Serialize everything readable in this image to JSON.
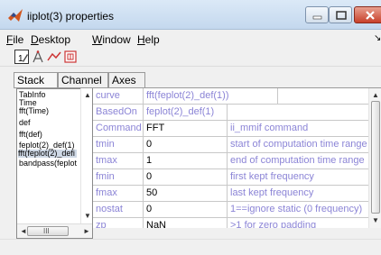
{
  "window": {
    "title": "iiplot(3) properties"
  },
  "menu": [
    {
      "label": "File",
      "ul": "F",
      "rest": "ile"
    },
    {
      "label": "Desktop",
      "ul": "D",
      "rest": "esktop"
    },
    {
      "label": "Window",
      "ul": "W",
      "rest": "indow"
    },
    {
      "label": "Help",
      "ul": "H",
      "rest": "elp"
    }
  ],
  "toolbar": [
    "text-tool-icon",
    "cursor-tool-icon",
    "line-tool-icon",
    "pin-tool-icon"
  ],
  "tabs": [
    "Stack",
    "Channel",
    "Axes"
  ],
  "active_tab": "Stack",
  "list": {
    "items": [
      "TabInfo",
      "Time",
      "fft(Time)",
      "def",
      "fft(def)",
      "feplot(2)_def(1)",
      "fft(feplot(2)_defi",
      "bandpass(feplot"
    ],
    "selected": "fft(feplot(2)_defi",
    "scroll_grip": "III"
  },
  "properties": [
    {
      "name": "curve",
      "value": "fft(feplot(2)_def(1))",
      "desc": "",
      "value_color": "purple"
    },
    {
      "name": "BasedOn",
      "value": "feplot(2)_def(1)",
      "desc": "",
      "value_color": "purple"
    },
    {
      "name": "Command",
      "value": "FFT",
      "desc": "ii_mmif command"
    },
    {
      "name": "tmin",
      "value": "0",
      "desc": "start of computation time range"
    },
    {
      "name": "tmax",
      "value": "1",
      "desc": "end of computation time range"
    },
    {
      "name": "fmin",
      "value": "0",
      "desc": "first kept frequency"
    },
    {
      "name": "fmax",
      "value": "50",
      "desc": "last kept frequency"
    },
    {
      "name": "nostat",
      "value": "0",
      "desc": "1==ignore static (0 frequency)",
      "dropdown": true
    },
    {
      "name": "zp",
      "value": "NaN",
      "desc": ">1 for zero padding"
    }
  ],
  "colors": {
    "label_purple": "#8b84d6",
    "titlebar": "#c4d8ee",
    "selection": "#cfd9e6"
  }
}
